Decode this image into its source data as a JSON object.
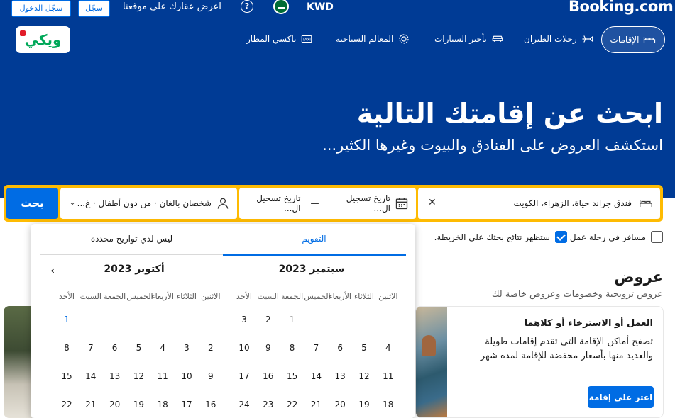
{
  "header": {
    "brand": "Booking.com",
    "currency": "KWD",
    "help_glyph": "?",
    "list_property": "اعرض عقارك على موقعنا",
    "register": "سجّل",
    "sign_in": "سجّل الدخول",
    "flag_icon": "saudi-flag-icon",
    "partner_logo_text": "ويكي"
  },
  "nav": {
    "stays": "الإقامات",
    "flights": "رحلات الطيران",
    "car_rentals": "تأجير السيارات",
    "attractions": "المعالم السياحية",
    "airport_taxis": "تاكسي المطار"
  },
  "hero": {
    "title": "ابحث عن إقامتك التالية",
    "subtitle": "استكشف العروض على الفنادق والبيوت وغيرها الكثير..."
  },
  "search": {
    "destination": "فندق جراند حياة، الزهراء، الكويت",
    "check_in": "تاريخ تسجيل ال...",
    "dash": "—",
    "check_out": "تاريخ تسجيل ال...",
    "guests": "شخصان بالغان · من دون أطفال · غ...",
    "button": "بحث",
    "accent": "#febb02",
    "primary": "#006ce4"
  },
  "options": {
    "business_trip": "مسافر في رحلة عمل",
    "map_results": "ستظهر نتائج بحثك على الخريطة.",
    "business_checked": false,
    "map_checked": true
  },
  "calendar": {
    "tab_calendar": "التقويم",
    "tab_flexible": "ليس لدي تواريخ محددة",
    "next_glyph": "‹",
    "months": [
      {
        "title": "سبتمبر 2023",
        "weekdays": [
          "الاثنين",
          "الثلاثاء",
          "الأربعاء",
          "الخميس",
          "الجمعة",
          "السبت",
          "الأحد"
        ],
        "rows": [
          [
            "",
            "",
            "",
            "",
            "1",
            "2",
            "3"
          ],
          [
            "4",
            "5",
            "6",
            "7",
            "8",
            "9",
            "10"
          ],
          [
            "11",
            "12",
            "13",
            "14",
            "15",
            "16",
            "17"
          ],
          [
            "18",
            "19",
            "20",
            "21",
            "22",
            "23",
            "24"
          ]
        ]
      },
      {
        "title": "أكتوبر 2023",
        "weekdays": [
          "الاثنين",
          "الثلاثاء",
          "الأربعاء",
          "الخميس",
          "الجمعة",
          "السبت",
          "الأحد"
        ],
        "rows": [
          [
            "",
            "",
            "",
            "",
            "",
            "",
            "1"
          ],
          [
            "2",
            "3",
            "4",
            "5",
            "6",
            "7",
            "8"
          ],
          [
            "9",
            "10",
            "11",
            "12",
            "13",
            "14",
            "15"
          ],
          [
            "16",
            "17",
            "18",
            "19",
            "20",
            "21",
            "22"
          ]
        ]
      }
    ]
  },
  "offers": {
    "title": "عروض",
    "subtitle": "عروض ترويجية وخصومات وعروض خاصة لك",
    "card_title": "العمل أو الاسترخاء أو كلاهما",
    "card_text": "تصفح أماكن الإقامة التي تقدم إقامات طويلة والعديد منها بأسعار مخفضة للإقامة لمدة شهر",
    "card_button": "اعثر على إقامة"
  }
}
